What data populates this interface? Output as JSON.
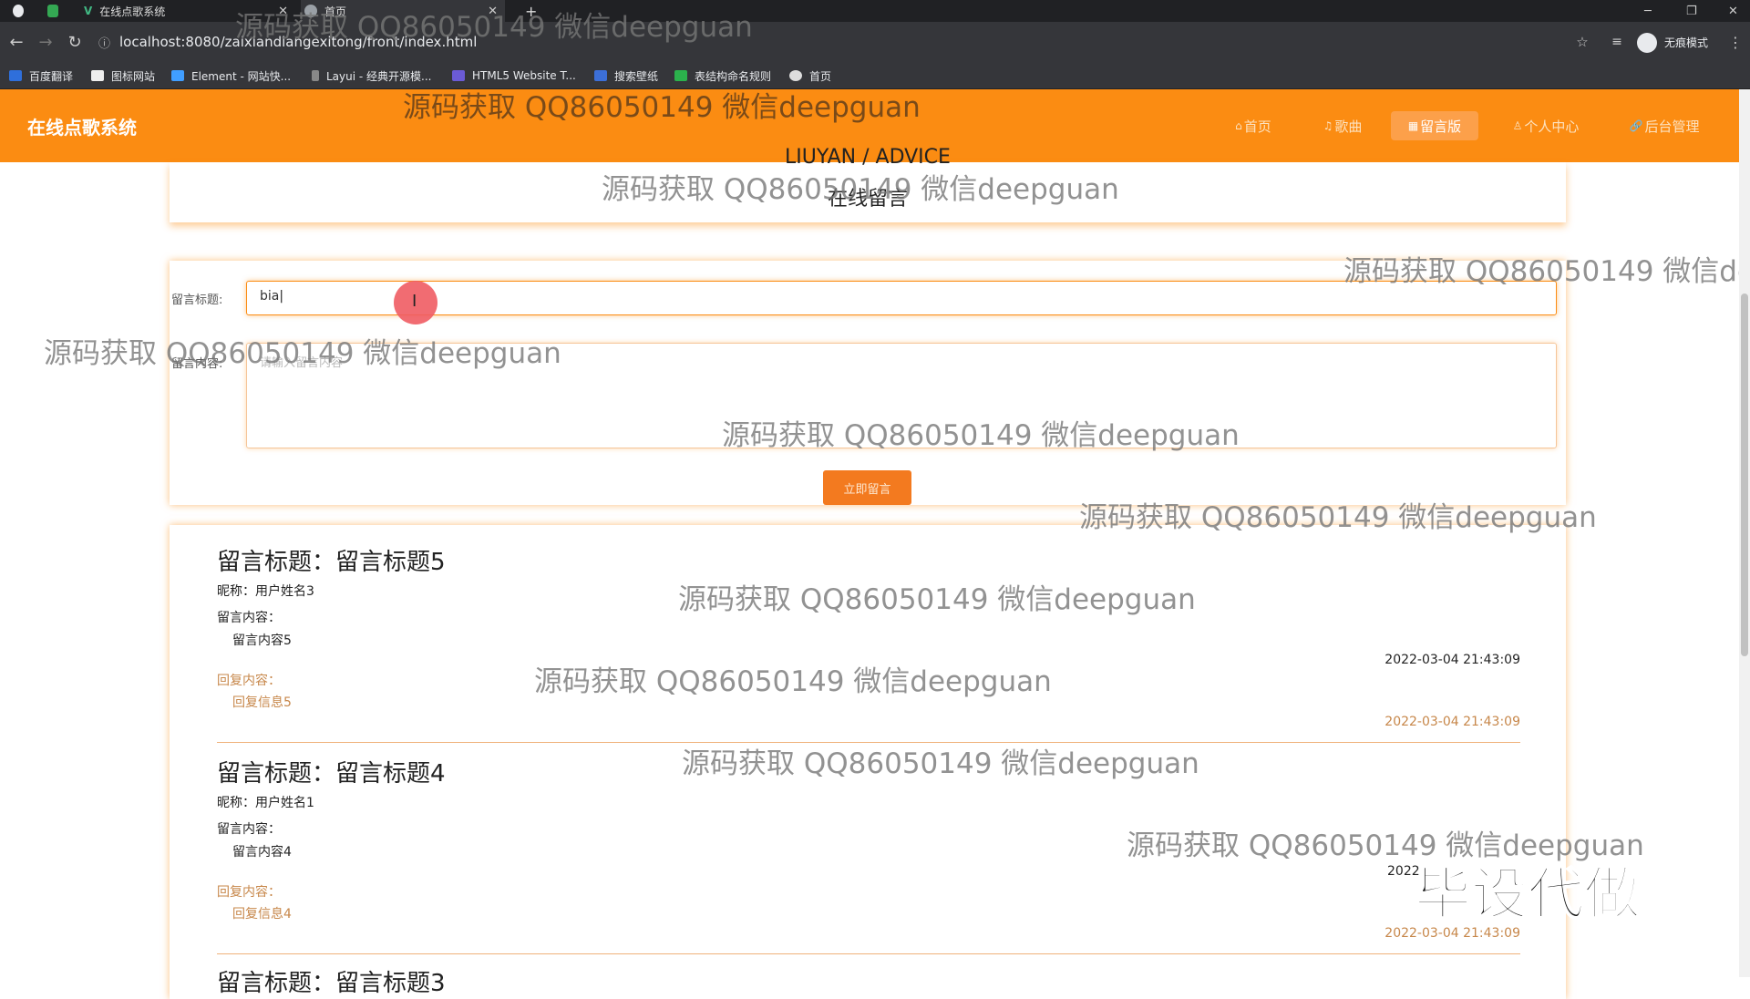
{
  "browser": {
    "tabs": [
      {
        "label": "在线点歌系统",
        "icon": "vue-logo-icon"
      },
      {
        "label": "首页",
        "icon": "globe-icon"
      }
    ],
    "new_tab_label": "+",
    "url": "localhost:8080/zaixiandiangexitong/front/index.html",
    "profile_label": "无痕模式",
    "bookmarks": [
      "百度翻译",
      "图标网站",
      "Element - 网站快...",
      "Layui - 经典开源模...",
      "HTML5 Website T...",
      "搜索壁纸",
      "表结构命名规则",
      "首页"
    ]
  },
  "site": {
    "brand": "在线点歌系统",
    "nav": [
      {
        "label": "首页",
        "icon": "home-icon"
      },
      {
        "label": "歌曲",
        "icon": "music-icon"
      },
      {
        "label": "留言版",
        "icon": "board-icon",
        "active": true
      },
      {
        "label": "个人中心",
        "icon": "user-icon"
      },
      {
        "label": "后台管理",
        "icon": "link-icon"
      }
    ]
  },
  "page": {
    "title_en": "LIUYAN / ADVICE",
    "title_cn": "在线留言"
  },
  "form": {
    "title_label": "留言标题:",
    "title_value": "bia",
    "content_label": "留言内容:",
    "content_placeholder": "请输入留言内容",
    "submit_label": "立即留言"
  },
  "messages": [
    {
      "title": "留言标题：留言标题5",
      "nickname": "昵称：用户姓名3",
      "content_label": "留言内容：",
      "content": "留言内容5",
      "reply_label": "回复内容：",
      "reply": "回复信息5",
      "time": "2022-03-04 21:43:09",
      "reply_time": "2022-03-04 21:43:09"
    },
    {
      "title": "留言标题：留言标题4",
      "nickname": "昵称：用户姓名1",
      "content_label": "留言内容：",
      "content": "留言内容4",
      "reply_label": "回复内容：",
      "reply": "回复信息4",
      "time": "2022",
      "reply_time": "2022-03-04 21:43:09"
    }
  ],
  "next_message_partial": "留言标题：留言标题3",
  "watermark": "源码获取 QQ86050149 微信deepguan",
  "watermark_cut": "源码获取 QQ86050149 微信dee",
  "watermark_big": "毕设代做",
  "colors": {
    "brand": "#fb8c12",
    "reply": "#c7874a",
    "button": "#f37a1f"
  }
}
